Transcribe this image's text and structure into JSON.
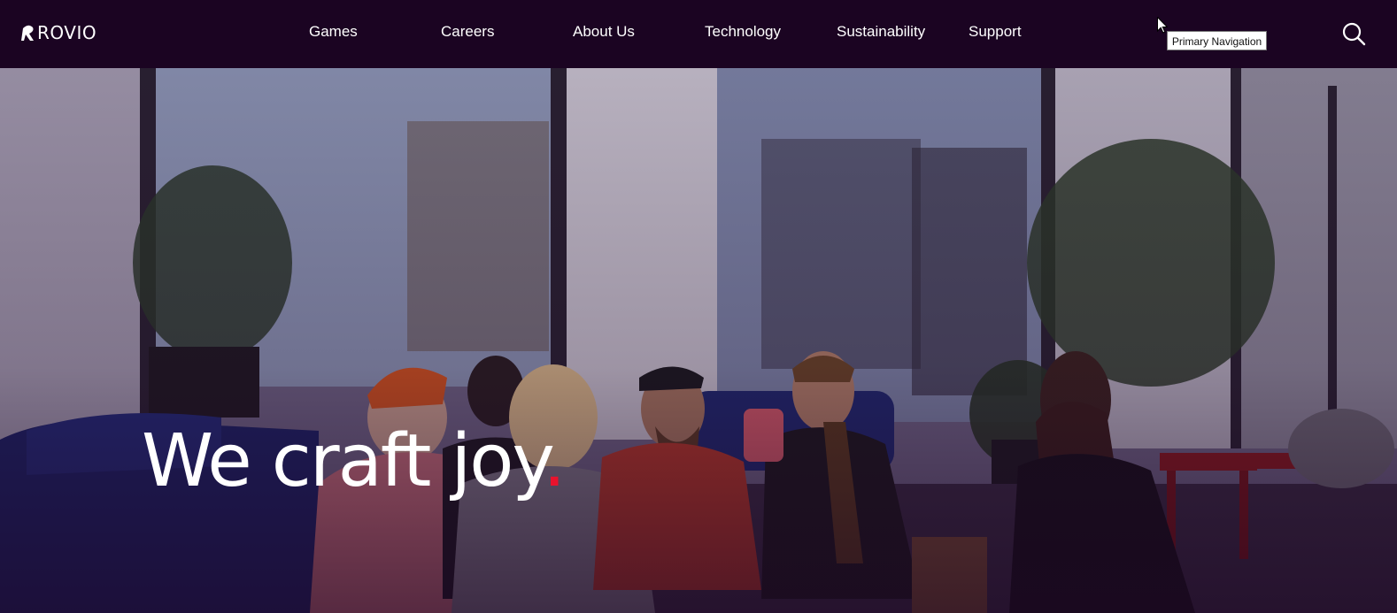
{
  "header": {
    "logo_text": "ROVIO",
    "nav": [
      {
        "label": "Games"
      },
      {
        "label": "Careers"
      },
      {
        "label": "About Us"
      },
      {
        "label": "Technology"
      },
      {
        "label": "Sustainability"
      },
      {
        "label": "Support"
      }
    ],
    "search_icon": "search-icon",
    "tooltip": "Primary Navigation"
  },
  "hero": {
    "headline": "We craft joy",
    "headline_dot": ".",
    "image_description_icon": "hero-photo"
  },
  "colors": {
    "header_bg": "#1b0422",
    "text": "#ffffff",
    "accent": "#e8132d"
  }
}
